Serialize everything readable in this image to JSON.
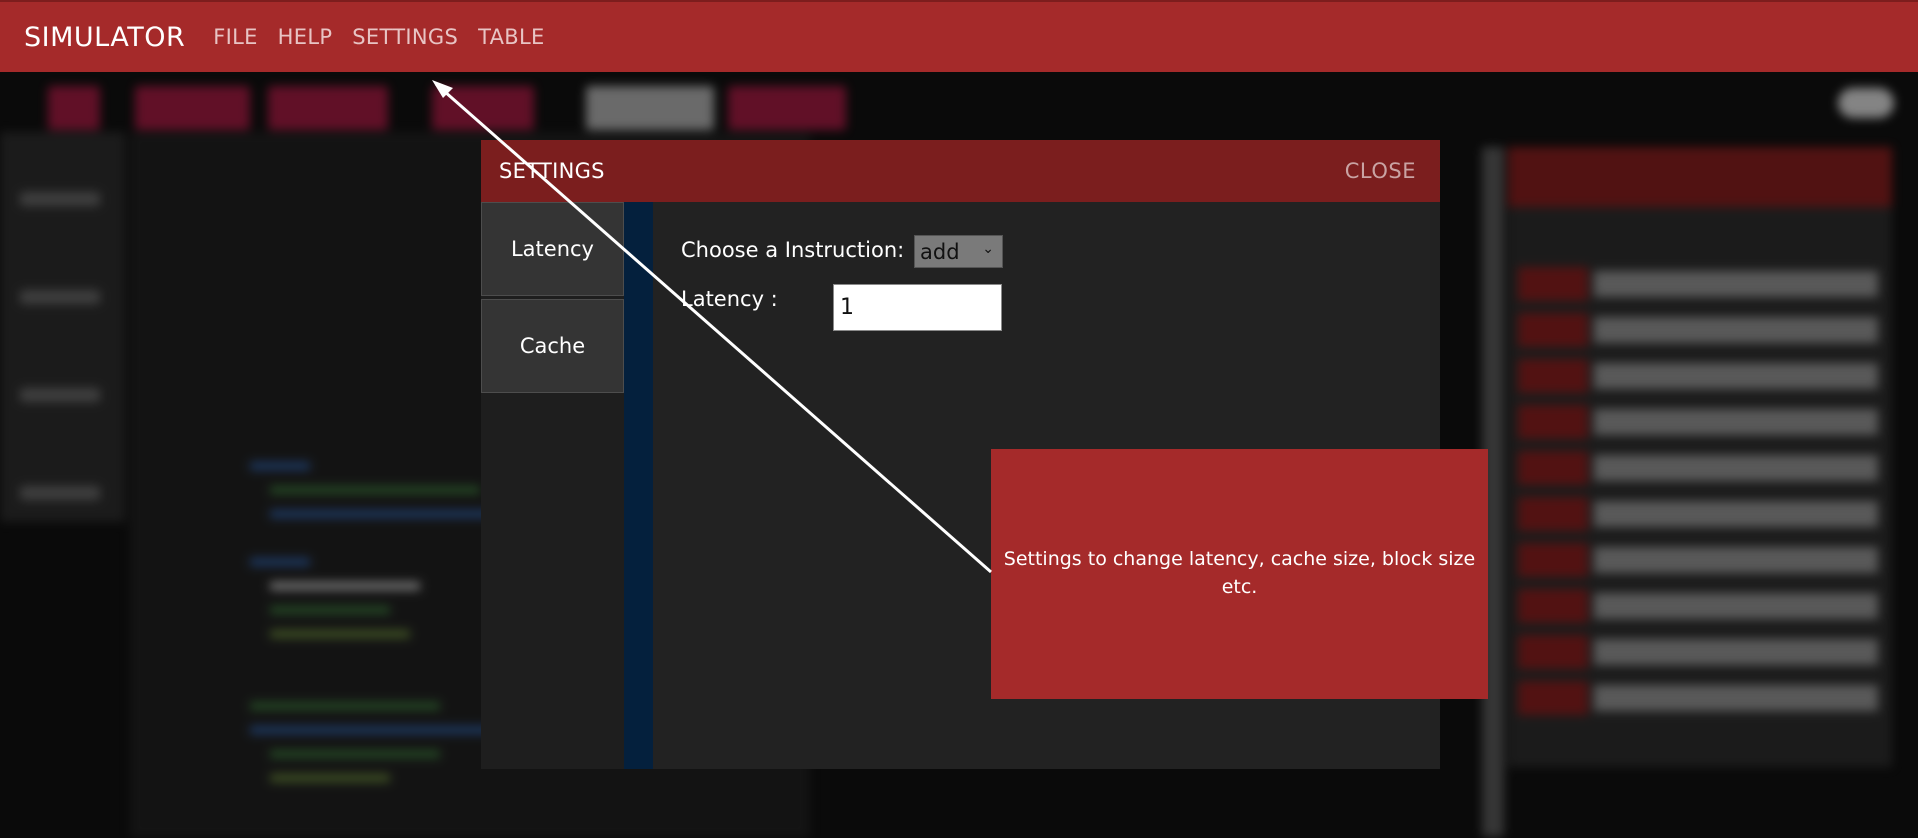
{
  "app": {
    "title": "SIMULATOR"
  },
  "menu": {
    "items": [
      {
        "label": "FILE"
      },
      {
        "label": "HELP"
      },
      {
        "label": "SETTINGS"
      },
      {
        "label": "TABLE"
      }
    ]
  },
  "settings_modal": {
    "title": "SETTINGS",
    "close_label": "CLOSE",
    "tabs": [
      {
        "label": "Latency"
      },
      {
        "label": "Cache"
      }
    ],
    "latency_panel": {
      "instruction_label": "Choose a Instruction:",
      "instruction_value": "add",
      "latency_label": "Latency :",
      "latency_value": "1"
    }
  },
  "tooltip": {
    "text": "Settings to change latency, cache size, block size etc."
  },
  "colors": {
    "topbar": "#a52a2a",
    "modal_header": "#7b1e1e",
    "accent_strip": "#04203d",
    "callout": "#a52a2a"
  }
}
